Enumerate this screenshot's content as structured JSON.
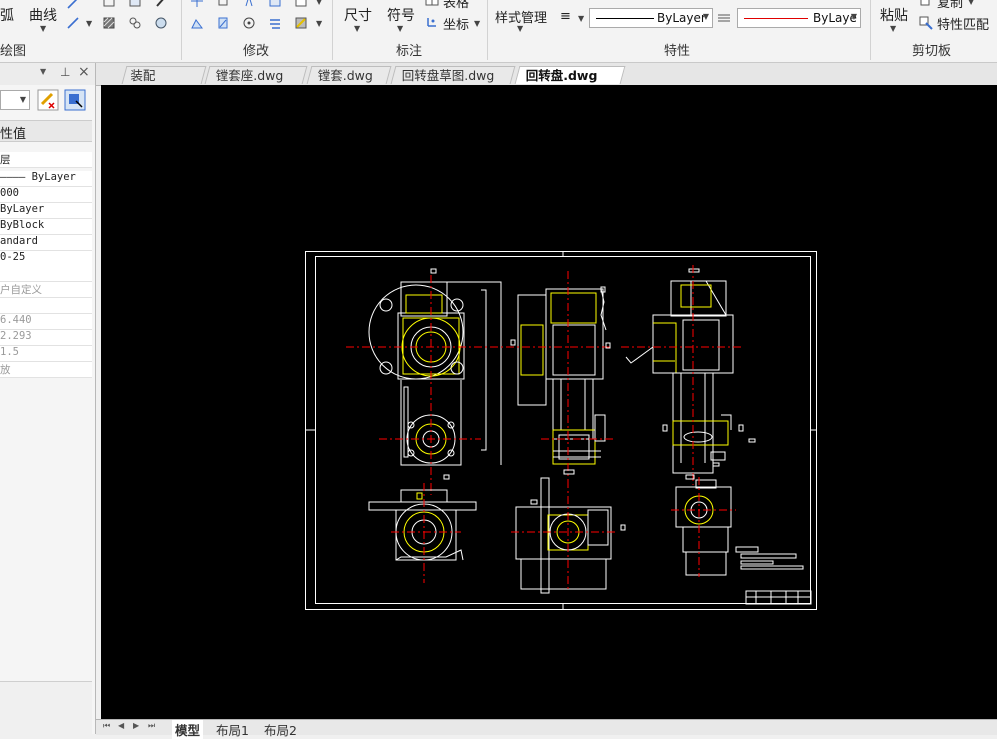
{
  "ribbon": {
    "draw_group": {
      "arc_label": "弧",
      "curve_label": "曲线",
      "group_label": "绘图"
    },
    "modify_group": {
      "group_label": "修改"
    },
    "annotate_group": {
      "dimension_label": "尺寸",
      "symbol_label": "符号",
      "table_label": "表格",
      "coordinate_label": "坐标",
      "group_label": "标注"
    },
    "properties_group": {
      "style_manager_label": "样式管理",
      "linetype_value": "ByLayer",
      "color_value": "ByLaye",
      "group_label": "特性"
    },
    "clipboard_group": {
      "paste_label": "粘贴",
      "copy_label": "复制",
      "match_label": "特性匹配",
      "group_label": "剪切板"
    }
  },
  "properties_panel": {
    "header": "性值",
    "rows": [
      {
        "text": "层",
        "grey": false
      },
      {
        "text": "———— ByLayer",
        "grey": false
      },
      {
        "text": "000",
        "grey": false
      },
      {
        "text": "      ByLayer",
        "grey": false
      },
      {
        "text": "ByBlock",
        "grey": false
      },
      {
        "text": "andard",
        "grey": false
      },
      {
        "text": "0-25",
        "grey": false
      },
      {
        "text": "",
        "grey": false
      },
      {
        "text": "户自定义",
        "grey": true
      },
      {
        "text": "",
        "grey": false
      },
      {
        "text": "6.440",
        "grey": true
      },
      {
        "text": "2.293",
        "grey": true
      },
      {
        "text": "1.5",
        "grey": true
      },
      {
        "text": "放",
        "grey": true
      }
    ]
  },
  "tabs": [
    {
      "label": "装配图.dwg",
      "active": false
    },
    {
      "label": "镗套座.dwg",
      "active": false
    },
    {
      "label": "镗套.dwg",
      "active": false
    },
    {
      "label": "回转盘草图.dwg",
      "active": false
    },
    {
      "label": "回转盘.dwg",
      "active": true
    }
  ],
  "close_glyph": "×",
  "layout_tabs": [
    {
      "label": "模型",
      "active": true
    },
    {
      "label": "布局1",
      "active": false
    },
    {
      "label": "布局2",
      "active": false
    }
  ],
  "colors": {
    "canvas": "#000000",
    "drawing_white": "#ffffff",
    "drawing_yellow": "#ffff00",
    "drawing_red": "#ff0000"
  }
}
